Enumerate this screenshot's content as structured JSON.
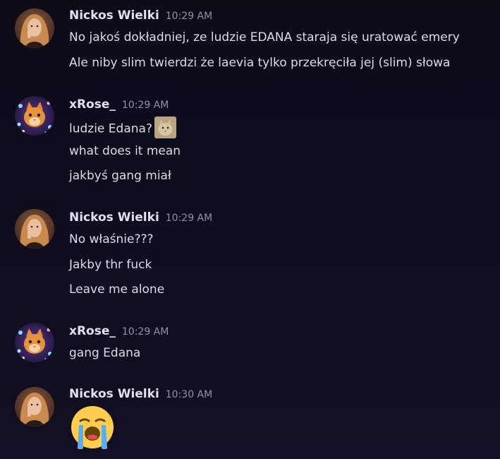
{
  "messages": [
    {
      "author": "Nickos Wielki",
      "time": "10:29 AM",
      "lines": [
        "No jakoś dokładniej, ze ludzie EDANA staraja się uratować emery",
        "Ale niby slim twierdzi że laevia tylko przekręciła jej (slim) słowa"
      ]
    },
    {
      "author": "xRose_",
      "time": "10:29 AM",
      "lines": [
        "ludzie Edana?",
        "what does it mean",
        "jakbyś gang miał"
      ]
    },
    {
      "author": "Nickos Wielki",
      "time": "10:29 AM",
      "lines": [
        "No właśnie???",
        "Jakby thr fuck",
        "Leave me alone"
      ]
    },
    {
      "author": "xRose_",
      "time": "10:29 AM",
      "lines": [
        "gang Edana"
      ]
    },
    {
      "author": "Nickos Wielki",
      "time": "10:30 AM",
      "emoji": "loudly-crying-face-emoji"
    }
  ],
  "icons": {
    "inline_emoji": "cat-sticker-emoji",
    "avatar_nickos": "woman-portrait-avatar",
    "avatar_rose": "orange-cat-avatar"
  },
  "colors": {
    "background": "#0f0d1d",
    "username": "#dfe0f2",
    "timestamp": "#9193a3",
    "text": "#dcdde3"
  }
}
